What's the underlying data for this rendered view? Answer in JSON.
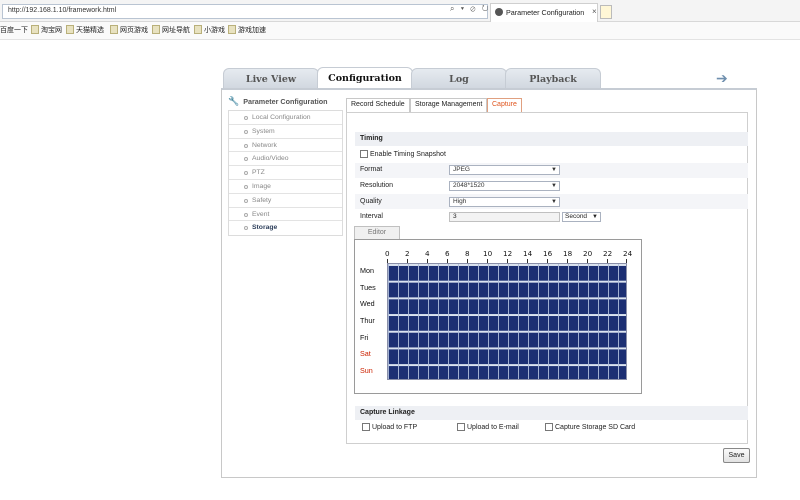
{
  "browser": {
    "url": "http://192.168.1.10/framework.html",
    "tab_title": "Parameter Configuration",
    "favorites": [
      "百度一下",
      "淘宝网",
      "天猫精选",
      "网页游戏",
      "网址导航",
      "小游戏",
      "游戏加速"
    ]
  },
  "main_tabs": [
    "Live View",
    "Configuration",
    "Log",
    "Playback"
  ],
  "sidebar": {
    "title": "Parameter Configuration",
    "items": [
      "Local Configuration",
      "System",
      "Network",
      "Audio/Video",
      "PTZ",
      "Image",
      "Safety",
      "Event",
      "Storage"
    ]
  },
  "sub_tabs": [
    "Record Schedule",
    "Storage Management",
    "Capture"
  ],
  "timing": {
    "header": "Timing",
    "enable_label": "Enable Timing Snapshot",
    "format_label": "Format",
    "format_value": "JPEG",
    "resolution_label": "Resolution",
    "resolution_value": "2048*1520",
    "quality_label": "Quality",
    "quality_value": "High",
    "interval_label": "Interval",
    "interval_value": "3",
    "interval_unit": "Second"
  },
  "editor": {
    "tab_label": "Editor",
    "hours": [
      "0",
      "2",
      "4",
      "6",
      "8",
      "10",
      "12",
      "14",
      "16",
      "18",
      "20",
      "22",
      "24"
    ],
    "days": [
      "Mon",
      "Tues",
      "Wed",
      "Thur",
      "Fri",
      "Sat",
      "Sun"
    ]
  },
  "linkage": {
    "header": "Capture Linkage",
    "options": [
      "Upload to FTP",
      "Upload to E-mail",
      "Capture Storage SD Card"
    ]
  },
  "save_label": "Save"
}
